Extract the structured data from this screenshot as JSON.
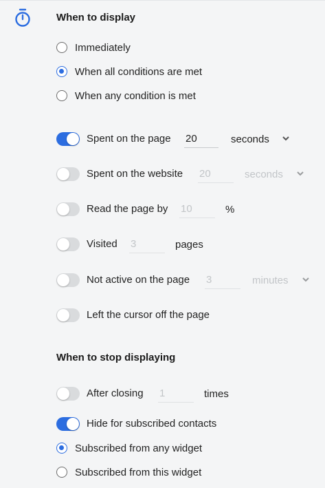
{
  "display": {
    "heading": "When to display",
    "options": [
      {
        "label": "Immediately",
        "selected": false
      },
      {
        "label": "When all conditions are met",
        "selected": true
      },
      {
        "label": "When any condition is met",
        "selected": false
      }
    ]
  },
  "conditions": [
    {
      "label": "Spent on the page",
      "on": true,
      "value": "20",
      "unit": "seconds",
      "dropdown": true
    },
    {
      "label": "Spent on the website",
      "on": false,
      "value": "20",
      "unit": "seconds",
      "dropdown": true
    },
    {
      "label": "Read the page by",
      "on": false,
      "value": "10",
      "unit": "%",
      "dropdown": false
    },
    {
      "label": "Visited",
      "on": false,
      "value": "3",
      "unit": "pages",
      "dropdown": false
    },
    {
      "label": "Not active on the page",
      "on": false,
      "value": "3",
      "unit": "minutes",
      "dropdown": true
    },
    {
      "label": "Left the cursor off the page",
      "on": false
    }
  ],
  "stop": {
    "heading": "When to stop displaying",
    "after_closing": {
      "label": "After closing",
      "on": false,
      "value": "1",
      "unit": "times"
    },
    "hide_subscribed": {
      "label": "Hide for subscribed contacts",
      "on": true
    },
    "options": [
      {
        "label": "Subscribed from any widget",
        "selected": true
      },
      {
        "label": "Subscribed from this widget",
        "selected": false
      }
    ]
  },
  "colors": {
    "accent": "#2c6de0",
    "toggle_off": "#d9dbdd",
    "background": "#f4f5f6"
  },
  "icons": {
    "section": "timer-icon",
    "dropdown": "chevron-down-icon"
  }
}
